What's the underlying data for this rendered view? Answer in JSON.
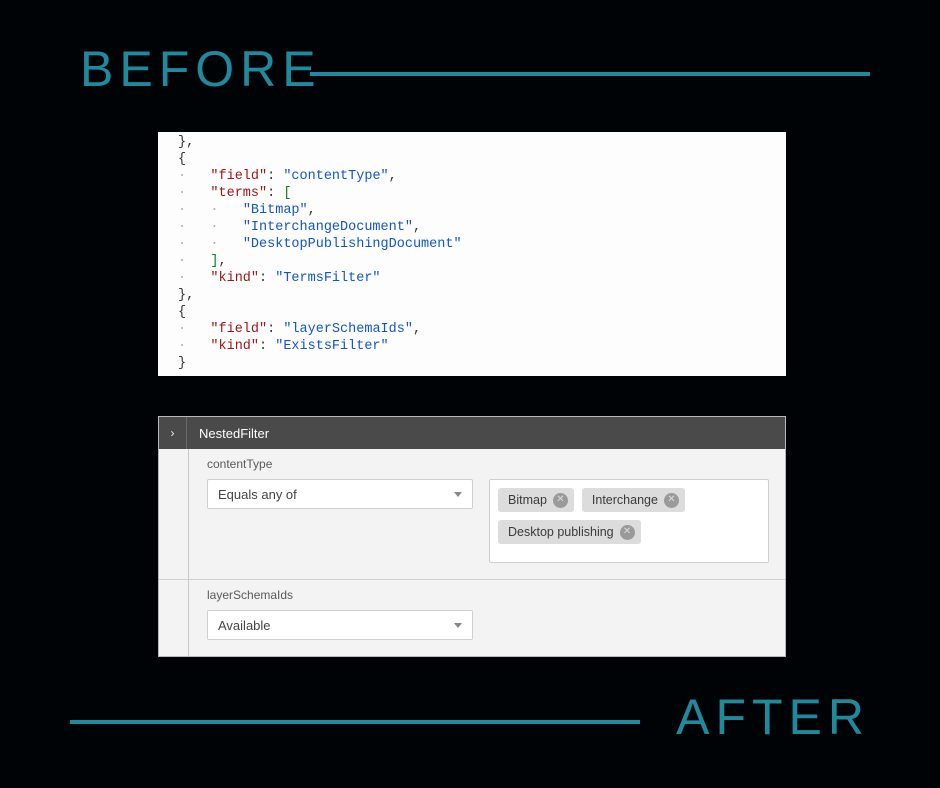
{
  "labels": {
    "before": "BEFORE",
    "after": "AFTER"
  },
  "colors": {
    "accent": "#1f8a9d",
    "bg": "#000305"
  },
  "code": {
    "lines": [
      {
        "indent": "",
        "parts": [
          {
            "t": "},",
            "c": "pun"
          }
        ]
      },
      {
        "indent": "",
        "parts": [
          {
            "t": "{",
            "c": "pun"
          }
        ]
      },
      {
        "indent": "·   ",
        "parts": [
          {
            "t": "\"field\"",
            "c": "key"
          },
          {
            "t": ": ",
            "c": "pun"
          },
          {
            "t": "\"contentType\"",
            "c": "str"
          },
          {
            "t": ",",
            "c": "pun"
          }
        ]
      },
      {
        "indent": "·   ",
        "parts": [
          {
            "t": "\"terms\"",
            "c": "key"
          },
          {
            "t": ": ",
            "c": "pun"
          },
          {
            "t": "[",
            "c": "brk"
          }
        ]
      },
      {
        "indent": "·   ·   ",
        "parts": [
          {
            "t": "\"Bitmap\"",
            "c": "str"
          },
          {
            "t": ",",
            "c": "pun"
          }
        ]
      },
      {
        "indent": "·   ·   ",
        "parts": [
          {
            "t": "\"InterchangeDocument\"",
            "c": "str"
          },
          {
            "t": ",",
            "c": "pun"
          }
        ]
      },
      {
        "indent": "·   ·   ",
        "parts": [
          {
            "t": "\"DesktopPublishingDocument\"",
            "c": "str"
          }
        ]
      },
      {
        "indent": "·   ",
        "parts": [
          {
            "t": "]",
            "c": "brk"
          },
          {
            "t": ",",
            "c": "pun"
          }
        ]
      },
      {
        "indent": "·   ",
        "parts": [
          {
            "t": "\"kind\"",
            "c": "key"
          },
          {
            "t": ": ",
            "c": "pun"
          },
          {
            "t": "\"TermsFilter\"",
            "c": "str"
          }
        ]
      },
      {
        "indent": "",
        "parts": [
          {
            "t": "},",
            "c": "pun"
          }
        ]
      },
      {
        "indent": "",
        "parts": [
          {
            "t": "{",
            "c": "pun"
          }
        ]
      },
      {
        "indent": "·   ",
        "parts": [
          {
            "t": "\"field\"",
            "c": "key"
          },
          {
            "t": ": ",
            "c": "pun"
          },
          {
            "t": "\"layerSchemaIds\"",
            "c": "str"
          },
          {
            "t": ",",
            "c": "pun"
          }
        ]
      },
      {
        "indent": "·   ",
        "parts": [
          {
            "t": "\"kind\"",
            "c": "key"
          },
          {
            "t": ": ",
            "c": "pun"
          },
          {
            "t": "\"ExistsFilter\"",
            "c": "str"
          }
        ]
      },
      {
        "indent": "",
        "parts": [
          {
            "t": "}",
            "c": "pun"
          }
        ]
      }
    ]
  },
  "ui": {
    "header": "NestedFilter",
    "sections": [
      {
        "label": "contentType",
        "select": "Equals any of",
        "chips": [
          "Bitmap",
          "Interchange",
          "Desktop publishing"
        ]
      },
      {
        "label": "layerSchemaIds",
        "select": "Available",
        "chips": []
      }
    ]
  }
}
